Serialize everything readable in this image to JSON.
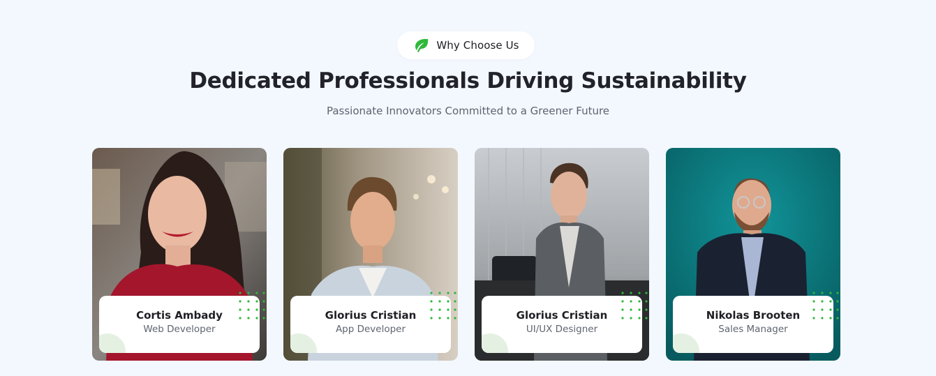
{
  "section": {
    "badge_label": "Why Choose Us",
    "badge_icon": "leaf-icon",
    "title": "Dedicated Professionals Driving Sustainability",
    "subtitle": "Passionate Innovators Committed to a Greener Future"
  },
  "team": [
    {
      "name": "Cortis Ambady",
      "role": "Web Developer"
    },
    {
      "name": "Glorius Cristian",
      "role": "App Developer"
    },
    {
      "name": "Glorius Cristian",
      "role": "UI/UX Designer"
    },
    {
      "name": "Nikolas Brooten",
      "role": "Sales Manager"
    }
  ],
  "colors": {
    "accent": "#2fb83a",
    "page_background": "#f3f8fe",
    "card_background": "#ffffff"
  }
}
